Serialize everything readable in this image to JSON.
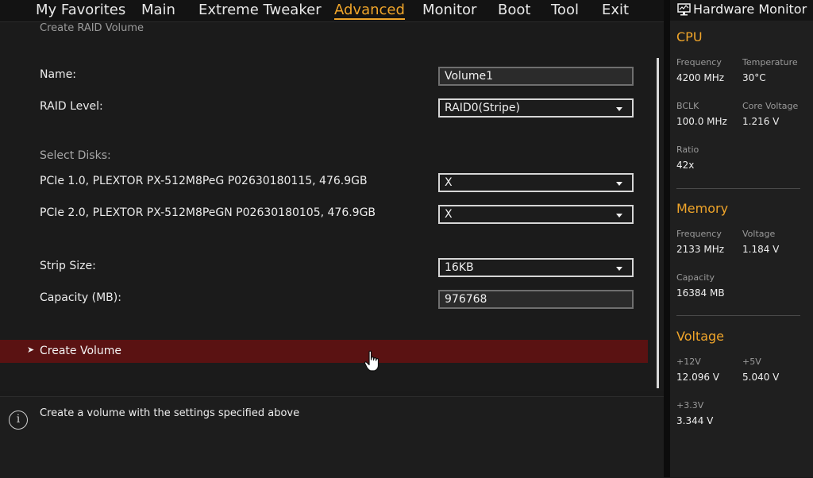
{
  "menu": {
    "items": [
      {
        "label": "My Favorites"
      },
      {
        "label": "Main"
      },
      {
        "label": "Extreme Tweaker"
      },
      {
        "label": "Advanced"
      },
      {
        "label": "Monitor"
      },
      {
        "label": "Boot"
      },
      {
        "label": "Tool"
      },
      {
        "label": "Exit"
      }
    ],
    "active": "Advanced"
  },
  "page": {
    "heading": "Create RAID Volume",
    "name_label": "Name:",
    "name_value": "Volume1",
    "raid_level_label": "RAID Level:",
    "raid_level_value": "RAID0(Stripe)",
    "select_disks_label": "Select Disks:",
    "disks": [
      {
        "label": "PCIe 1.0, PLEXTOR PX-512M8PeG P02630180115, 476.9GB",
        "value": "X"
      },
      {
        "label": "PCIe 2.0, PLEXTOR PX-512M8PeGN P02630180105, 476.9GB",
        "value": "X"
      }
    ],
    "strip_size_label": "Strip Size:",
    "strip_size_value": "16KB",
    "capacity_label": "Capacity (MB):",
    "capacity_value": "976768",
    "create_volume_label": "Create Volume"
  },
  "help": {
    "icon": "info-icon",
    "text": "Create a volume with the settings specified above"
  },
  "hardware_monitor": {
    "title": "Hardware Monitor",
    "cpu": {
      "title": "CPU",
      "frequency_label": "Frequency",
      "frequency_value": "4200 MHz",
      "temperature_label": "Temperature",
      "temperature_value": "30°C",
      "bclk_label": "BCLK",
      "bclk_value": "100.0 MHz",
      "core_voltage_label": "Core Voltage",
      "core_voltage_value": "1.216 V",
      "ratio_label": "Ratio",
      "ratio_value": "42x"
    },
    "memory": {
      "title": "Memory",
      "frequency_label": "Frequency",
      "frequency_value": "2133 MHz",
      "voltage_label": "Voltage",
      "voltage_value": "1.184 V",
      "capacity_label": "Capacity",
      "capacity_value": "16384 MB"
    },
    "voltage": {
      "title": "Voltage",
      "v12_label": "+12V",
      "v12_value": "12.096 V",
      "v5_label": "+5V",
      "v5_value": "5.040 V",
      "v33_label": "+3.3V",
      "v33_value": "3.344 V"
    }
  },
  "colors": {
    "accent": "#f0a52a",
    "selected_row": "#5a1212",
    "background": "#1a1a1a"
  }
}
